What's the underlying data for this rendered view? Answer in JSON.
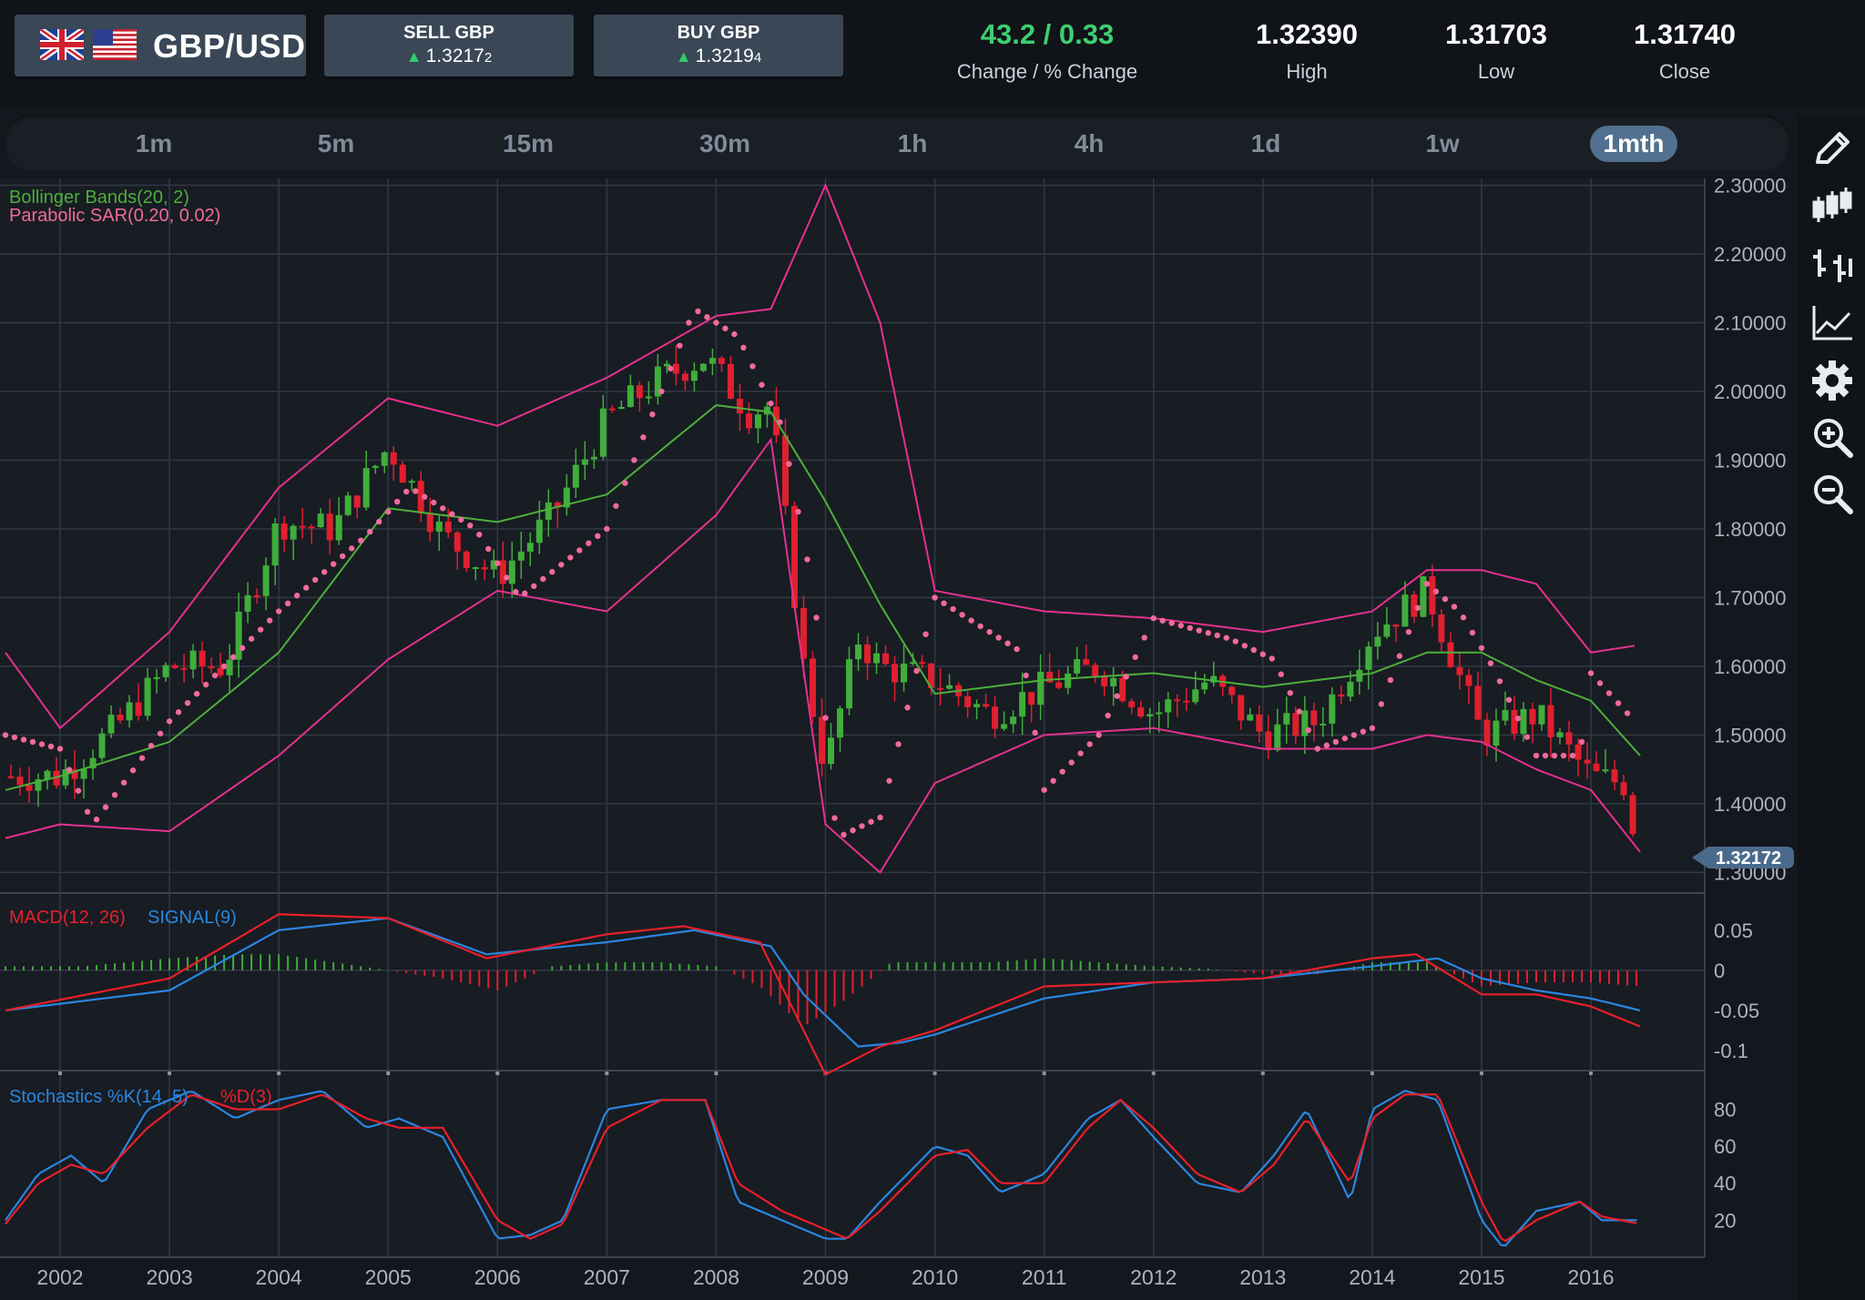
{
  "header": {
    "pair": "GBP/USD",
    "flags": [
      "uk-flag-icon",
      "us-flag-icon"
    ],
    "sell": {
      "label": "SELL GBP",
      "price_main": "1.3217",
      "price_pip": "2"
    },
    "buy": {
      "label": "BUY GBP",
      "price_main": "1.3219",
      "price_pip": "4"
    },
    "change": {
      "value": "43.2 / 0.33",
      "label": "Change / % Change"
    },
    "high": {
      "value": "1.32390",
      "label": "High"
    },
    "low": {
      "value": "1.31703",
      "label": "Low"
    },
    "close": {
      "value": "1.31740",
      "label": "Close"
    }
  },
  "timeframes": [
    {
      "label": "1m"
    },
    {
      "label": "5m"
    },
    {
      "label": "15m"
    },
    {
      "label": "30m"
    },
    {
      "label": "1h"
    },
    {
      "label": "4h"
    },
    {
      "label": "1d"
    },
    {
      "label": "1w"
    },
    {
      "label": "1mth",
      "active": true
    }
  ],
  "toolbar": [
    "pencil-icon",
    "candlestick-icon",
    "ohlc-bars-icon",
    "line-chart-icon",
    "gear-icon",
    "zoom-in-icon",
    "zoom-out-icon"
  ],
  "colors": {
    "background": "#14171d",
    "grid": "#323945",
    "up": "#3fae3a",
    "down": "#e0202e",
    "bollinger": "#e4318f",
    "bollinger_mid": "#4caf3a",
    "sar": "#f06a9c",
    "macd": "#e8202a",
    "signal": "#2a86e0",
    "stoch_k": "#2a86e0",
    "stoch_d": "#e8202a",
    "price_tag": "#4a6a8c"
  },
  "chart_data": [
    {
      "type": "candlestick",
      "panel": "price",
      "indicators": [
        "Bollinger Bands(20, 2)",
        "Parabolic SAR(0.20, 0.02)"
      ],
      "x_ticks": [
        "2002",
        "2003",
        "2004",
        "2005",
        "2006",
        "2007",
        "2008",
        "2009",
        "2010",
        "2011",
        "2012",
        "2013",
        "2014",
        "2015",
        "2016"
      ],
      "y_ticks": [
        "2.30000",
        "2.20000",
        "2.10000",
        "2.00000",
        "1.90000",
        "1.80000",
        "1.70000",
        "1.60000",
        "1.50000",
        "1.40000",
        "1.30000"
      ],
      "ylim": [
        1.27,
        2.31
      ],
      "current_price": "1.32172",
      "close_x": [
        2002.0,
        2002.5,
        2003.0,
        2003.5,
        2004.0,
        2004.5,
        2005.0,
        2005.5,
        2006.0,
        2006.5,
        2007.0,
        2007.5,
        2007.9,
        2008.3,
        2008.5,
        2008.8,
        2009.0,
        2009.3,
        2009.5,
        2010.0,
        2010.5,
        2011.0,
        2011.5,
        2012.0,
        2012.5,
        2013.0,
        2013.5,
        2014.0,
        2014.5,
        2015.0,
        2015.5,
        2016.0,
        2016.3,
        2016.45
      ],
      "close": [
        1.44,
        1.51,
        1.6,
        1.6,
        1.81,
        1.8,
        1.92,
        1.79,
        1.73,
        1.82,
        1.96,
        2.02,
        2.05,
        1.97,
        1.98,
        1.6,
        1.45,
        1.64,
        1.6,
        1.58,
        1.53,
        1.57,
        1.6,
        1.53,
        1.58,
        1.5,
        1.52,
        1.65,
        1.71,
        1.5,
        1.53,
        1.44,
        1.43,
        1.32
      ],
      "bollinger_upper": {
        "x": [
          2001.5,
          2002.0,
          2003.0,
          2004.0,
          2005.0,
          2006.0,
          2007.0,
          2008.0,
          2008.5,
          2009.0,
          2009.5,
          2010.0,
          2011.0,
          2012.0,
          2013.0,
          2014.0,
          2014.5,
          2015.0,
          2015.5,
          2016.0,
          2016.4
        ],
        "y": [
          1.62,
          1.51,
          1.65,
          1.86,
          1.99,
          1.95,
          2.02,
          2.11,
          2.12,
          2.3,
          2.1,
          1.71,
          1.68,
          1.67,
          1.65,
          1.68,
          1.74,
          1.74,
          1.72,
          1.62,
          1.63
        ]
      },
      "bollinger_middle": {
        "x": [
          2001.5,
          2002.0,
          2003.0,
          2004.0,
          2005.0,
          2006.0,
          2007.0,
          2008.0,
          2008.5,
          2009.0,
          2009.5,
          2010.0,
          2011.0,
          2012.0,
          2013.0,
          2014.0,
          2014.5,
          2015.0,
          2015.5,
          2016.0,
          2016.45
        ],
        "y": [
          1.42,
          1.44,
          1.49,
          1.62,
          1.83,
          1.81,
          1.85,
          1.98,
          1.97,
          1.84,
          1.69,
          1.56,
          1.58,
          1.59,
          1.57,
          1.59,
          1.62,
          1.62,
          1.58,
          1.55,
          1.47
        ]
      },
      "bollinger_lower": {
        "x": [
          2001.5,
          2002.0,
          2003.0,
          2004.0,
          2005.0,
          2006.0,
          2007.0,
          2008.0,
          2008.5,
          2009.0,
          2009.5,
          2010.0,
          2011.0,
          2012.0,
          2013.0,
          2014.0,
          2014.5,
          2015.0,
          2015.5,
          2016.0,
          2016.45
        ],
        "y": [
          1.35,
          1.37,
          1.36,
          1.47,
          1.61,
          1.71,
          1.68,
          1.82,
          1.93,
          1.37,
          1.3,
          1.43,
          1.5,
          1.51,
          1.48,
          1.48,
          1.5,
          1.49,
          1.45,
          1.42,
          1.33
        ]
      },
      "sar": {
        "x": [
          2001.5,
          2002.0,
          2002.3,
          2003.0,
          2004.0,
          2004.8,
          2005.2,
          2005.8,
          2006.2,
          2007.0,
          2007.8,
          2008.2,
          2008.6,
          2008.9,
          2009.1,
          2009.5,
          2010.0,
          2010.4,
          2010.8,
          2011.0,
          2011.5,
          2012.0,
          2012.7,
          2013.1,
          2013.5,
          2014.0,
          2014.5,
          2014.8,
          2015.1,
          2015.5,
          2015.9,
          2016.0,
          2016.4
        ],
        "y": [
          1.5,
          1.48,
          1.37,
          1.52,
          1.68,
          1.79,
          1.86,
          1.8,
          1.7,
          1.8,
          2.12,
          2.08,
          1.95,
          1.7,
          1.35,
          1.38,
          1.7,
          1.66,
          1.62,
          1.42,
          1.5,
          1.67,
          1.64,
          1.61,
          1.48,
          1.51,
          1.72,
          1.68,
          1.6,
          1.47,
          1.47,
          1.59,
          1.52
        ]
      }
    },
    {
      "type": "line",
      "panel": "macd",
      "label_macd": "MACD(12, 26)",
      "label_signal": "SIGNAL(9)",
      "y_ticks": [
        "0.05",
        "0",
        "-0.05",
        "-0.1"
      ],
      "ylim": [
        -0.125,
        0.085
      ],
      "macd": {
        "x": [
          2001.5,
          2003.0,
          2004.0,
          2005.0,
          2005.9,
          2007.0,
          2007.7,
          2008.4,
          2008.6,
          2009.0,
          2009.5,
          2010.0,
          2011.0,
          2012.0,
          2013.0,
          2014.0,
          2014.4,
          2015.0,
          2015.5,
          2016.0,
          2016.45
        ],
        "y": [
          -0.05,
          -0.01,
          0.07,
          0.065,
          0.015,
          0.045,
          0.055,
          0.035,
          -0.02,
          -0.13,
          -0.095,
          -0.075,
          -0.02,
          -0.015,
          -0.01,
          0.015,
          0.02,
          -0.03,
          -0.03,
          -0.045,
          -0.07
        ]
      },
      "signal": {
        "x": [
          2001.5,
          2003.0,
          2004.0,
          2005.0,
          2005.9,
          2007.0,
          2007.8,
          2008.5,
          2008.8,
          2009.3,
          2009.7,
          2010.0,
          2011.0,
          2012.0,
          2013.0,
          2014.0,
          2014.6,
          2015.0,
          2015.5,
          2016.0,
          2016.45
        ],
        "y": [
          -0.05,
          -0.025,
          0.05,
          0.065,
          0.02,
          0.035,
          0.05,
          0.03,
          -0.03,
          -0.095,
          -0.09,
          -0.08,
          -0.035,
          -0.015,
          -0.01,
          0.005,
          0.015,
          -0.01,
          -0.025,
          -0.035,
          -0.05
        ]
      },
      "histogram": {
        "x": [
          2002.2,
          2003.0,
          2003.6,
          2004.0,
          2004.5,
          2005.5,
          2006.0,
          2006.5,
          2007.0,
          2007.5,
          2008.0,
          2008.4,
          2008.8,
          2009.2,
          2009.6,
          2010.0,
          2010.5,
          2011.0,
          2011.5,
          2012.0,
          2012.5,
          2013.0,
          2013.5,
          2014.0,
          2014.5,
          2015.0,
          2015.5,
          2016.0,
          2016.45
        ],
        "y": [
          0.005,
          0.015,
          0.02,
          0.02,
          0.01,
          -0.01,
          -0.025,
          0.005,
          0.01,
          0.01,
          0.005,
          -0.02,
          -0.07,
          -0.035,
          0.01,
          0.01,
          0.01,
          0.015,
          0.01,
          0.005,
          0.002,
          -0.005,
          -0.005,
          0.01,
          0.01,
          -0.02,
          -0.015,
          -0.015,
          -0.02
        ]
      }
    },
    {
      "type": "line",
      "panel": "stochastics",
      "label_k": "Stochastics %K(14, 5)",
      "label_d": "%D(3)",
      "y_ticks": [
        "80",
        "60",
        "40",
        "20"
      ],
      "ylim": [
        0,
        95
      ],
      "k": {
        "x": [
          2001.5,
          2001.8,
          2002.1,
          2002.4,
          2002.8,
          2003.2,
          2003.6,
          2004.0,
          2004.4,
          2004.8,
          2005.1,
          2005.5,
          2006.0,
          2006.3,
          2006.6,
          2007.0,
          2007.5,
          2007.9,
          2008.2,
          2008.6,
          2009.0,
          2009.2,
          2009.5,
          2010.0,
          2010.3,
          2010.6,
          2011.0,
          2011.4,
          2011.7,
          2012.0,
          2012.4,
          2012.8,
          2013.1,
          2013.4,
          2013.8,
          2014.0,
          2014.3,
          2014.6,
          2015.0,
          2015.2,
          2015.5,
          2015.9,
          2016.1,
          2016.45
        ],
        "y": [
          20,
          45,
          55,
          40,
          80,
          90,
          75,
          85,
          90,
          70,
          75,
          65,
          10,
          12,
          20,
          80,
          85,
          85,
          30,
          20,
          10,
          10,
          30,
          60,
          55,
          35,
          45,
          75,
          85,
          65,
          40,
          35,
          55,
          80,
          30,
          80,
          90,
          85,
          20,
          5,
          25,
          30,
          20,
          20
        ]
      },
      "d": {
        "x": [
          2001.5,
          2001.8,
          2002.1,
          2002.4,
          2002.8,
          2003.2,
          2003.6,
          2004.0,
          2004.4,
          2004.8,
          2005.1,
          2005.5,
          2006.0,
          2006.3,
          2006.6,
          2007.0,
          2007.5,
          2007.9,
          2008.2,
          2008.6,
          2009.0,
          2009.2,
          2009.5,
          2010.0,
          2010.3,
          2010.6,
          2011.0,
          2011.4,
          2011.7,
          2012.0,
          2012.4,
          2012.8,
          2013.1,
          2013.4,
          2013.8,
          2014.0,
          2014.3,
          2014.6,
          2015.0,
          2015.2,
          2015.5,
          2015.9,
          2016.1,
          2016.45
        ],
        "y": [
          18,
          40,
          50,
          45,
          70,
          88,
          80,
          80,
          88,
          75,
          70,
          70,
          20,
          10,
          18,
          70,
          85,
          85,
          40,
          25,
          15,
          10,
          25,
          55,
          58,
          40,
          40,
          70,
          85,
          70,
          45,
          35,
          50,
          75,
          40,
          75,
          88,
          88,
          30,
          8,
          20,
          30,
          22,
          18
        ]
      }
    }
  ]
}
